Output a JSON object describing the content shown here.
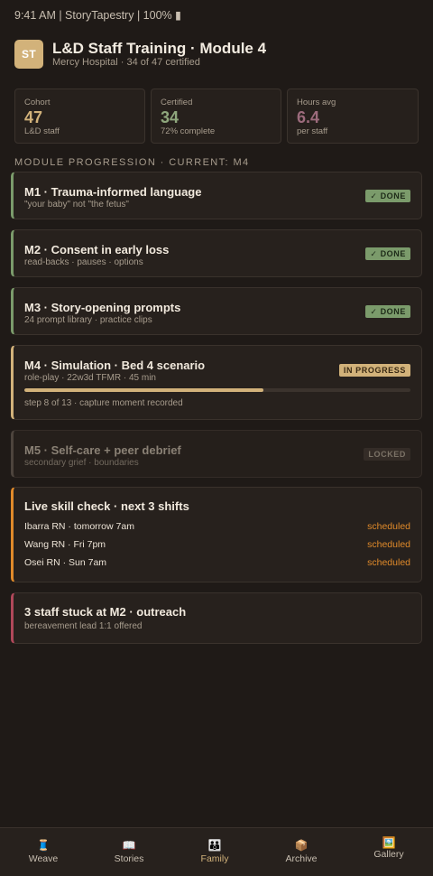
{
  "status_bar": {
    "text": "9:41 AM | StoryTapestry | 100% ▮"
  },
  "header": {
    "avatar": "ST",
    "title": "L&D Staff Training · Module 4",
    "subtitle": "Mercy Hospital · 34 of 47 certified"
  },
  "stats": [
    {
      "label": "Cohort",
      "value": "47",
      "sub": "L&D staff",
      "color": "#d2b27a"
    },
    {
      "label": "Certified",
      "value": "34",
      "sub": "72% complete",
      "color": "#8fa77d"
    },
    {
      "label": "Hours avg",
      "value": "6.4",
      "sub": "per staff",
      "color": "#9c6b7c"
    }
  ],
  "section_label": "MODULE PROGRESSION · CURRENT: M4",
  "modules": [
    {
      "title": "M1 · Trauma-informed language",
      "sub": "\"your baby\" not \"the fetus\"",
      "badge": "✓ DONE",
      "state": "done"
    },
    {
      "title": "M2 · Consent in early loss",
      "sub": "read-backs · pauses · options",
      "badge": "✓ DONE",
      "state": "done"
    },
    {
      "title": "M3 · Story-opening prompts",
      "sub": "24 prompt library · practice clips",
      "badge": "✓ DONE",
      "state": "done"
    },
    {
      "title": "M4 · Simulation · Bed 4 scenario",
      "sub": "role-play · 22w3d TFMR · 45 min",
      "badge": "IN PROGRESS",
      "state": "progress",
      "progress_text": "step 8 of 13 · capture moment recorded",
      "progress": 0.62
    },
    {
      "title": "M5 · Self-care + peer debrief",
      "sub": "secondary grief · boundaries",
      "badge": "LOCKED",
      "state": "locked"
    }
  ],
  "skill_check": {
    "title": "Live skill check · next 3 shifts",
    "rows": [
      {
        "name": "Ibarra RN · tomorrow 7am",
        "status": "scheduled"
      },
      {
        "name": "Wang RN · Fri 7pm",
        "status": "scheduled"
      },
      {
        "name": "Osei RN · Sun 7am",
        "status": "scheduled"
      }
    ]
  },
  "outreach": {
    "title": "3 staff stuck at M2 · outreach",
    "sub": "bereavement lead 1:1 offered"
  },
  "tabs": [
    {
      "label": "Weave",
      "icon": "🧵",
      "icon_name": "thread-icon",
      "active": false
    },
    {
      "label": "Stories",
      "icon": "📖",
      "icon_name": "book-icon",
      "active": false
    },
    {
      "label": "Family",
      "icon": "👪",
      "icon_name": "family-icon",
      "active": true
    },
    {
      "label": "Archive",
      "icon": "📦",
      "icon_name": "box-icon",
      "active": false
    },
    {
      "label": "Gallery",
      "icon": "🖼️",
      "icon_name": "picture-icon",
      "active": false
    }
  ],
  "colors": {
    "background": "#1f1a17",
    "accent": "#d2b27a",
    "done": "#7b9b6b",
    "warning": "#e08a2a",
    "alert": "#b0485a"
  }
}
